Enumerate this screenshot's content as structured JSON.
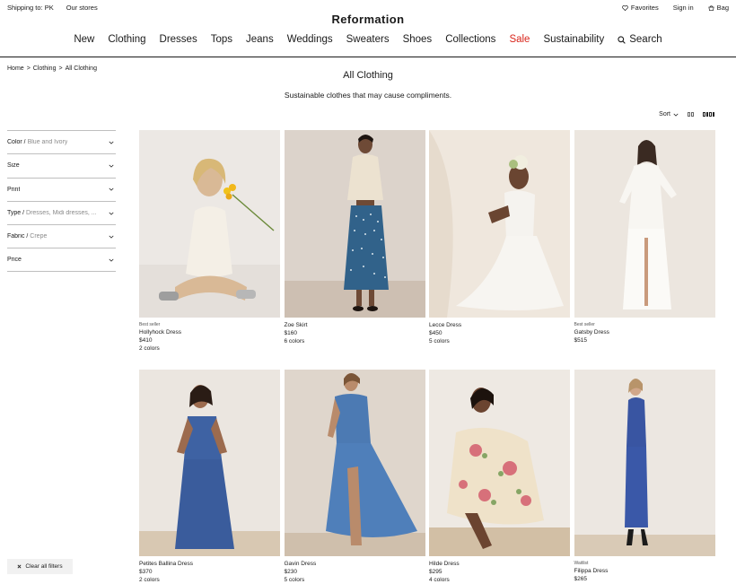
{
  "topbar": {
    "shipping": "Shipping to: PK",
    "stores": "Our stores",
    "favorites": "Favorites",
    "sign_in": "Sign in",
    "bag": "Bag"
  },
  "brand": "Reformation",
  "nav": [
    "New",
    "Clothing",
    "Dresses",
    "Tops",
    "Jeans",
    "Weddings",
    "Sweaters",
    "Shoes",
    "Collections",
    "Sale",
    "Sustainability",
    "Search"
  ],
  "breadcrumb": [
    "Home",
    "Clothing",
    "All Clothing"
  ],
  "breadcrumb_sep": ">",
  "title": "All Clothing",
  "subtitle": "Sustainable clothes that may cause compliments.",
  "sort_label": "Sort",
  "filters": [
    {
      "label": "Color",
      "value": "Blue and Ivory"
    },
    {
      "label": "Size",
      "value": ""
    },
    {
      "label": "Print",
      "value": ""
    },
    {
      "label": "Type",
      "value": "Dresses, Midi dresses, ..."
    },
    {
      "label": "Fabric",
      "value": "Crepe"
    },
    {
      "label": "Price",
      "value": ""
    }
  ],
  "clear_filters": "Clear all filters",
  "products": [
    {
      "badge": "Best seller",
      "name": "Hollyhock Dress",
      "price": "$410",
      "colors": "2 colors"
    },
    {
      "badge": "",
      "name": "Zoe Skirt",
      "price": "$160",
      "colors": "6 colors"
    },
    {
      "badge": "",
      "name": "Lecce Dress",
      "price": "$450",
      "colors": "5 colors"
    },
    {
      "badge": "Best seller",
      "name": "Gatsby Dress",
      "price": "$515",
      "colors": ""
    },
    {
      "badge": "",
      "name": "Petites Ballina Dress",
      "price": "$370",
      "colors": "2 colors"
    },
    {
      "badge": "",
      "name": "Gavin Dress",
      "price": "$230",
      "colors": "5 colors"
    },
    {
      "badge": "",
      "name": "Hilde Dress",
      "price": "$295",
      "colors": "4 colors"
    },
    {
      "badge": "Waitlist",
      "name": "Filippa Dress",
      "price": "$265",
      "colors": ""
    }
  ],
  "colors": {
    "sale": "#d9261c",
    "text": "#1a1a1a",
    "muted": "#8a8a8a",
    "divider": "#bfbfbf"
  },
  "icons": {
    "favorites": "heart-icon",
    "bag": "bag-icon",
    "search": "search-icon",
    "filter_toggle": "chevron-down-icon",
    "clear": "close-icon",
    "grid_2": "grid-two-columns-icon",
    "grid_4": "grid-four-columns-icon"
  }
}
